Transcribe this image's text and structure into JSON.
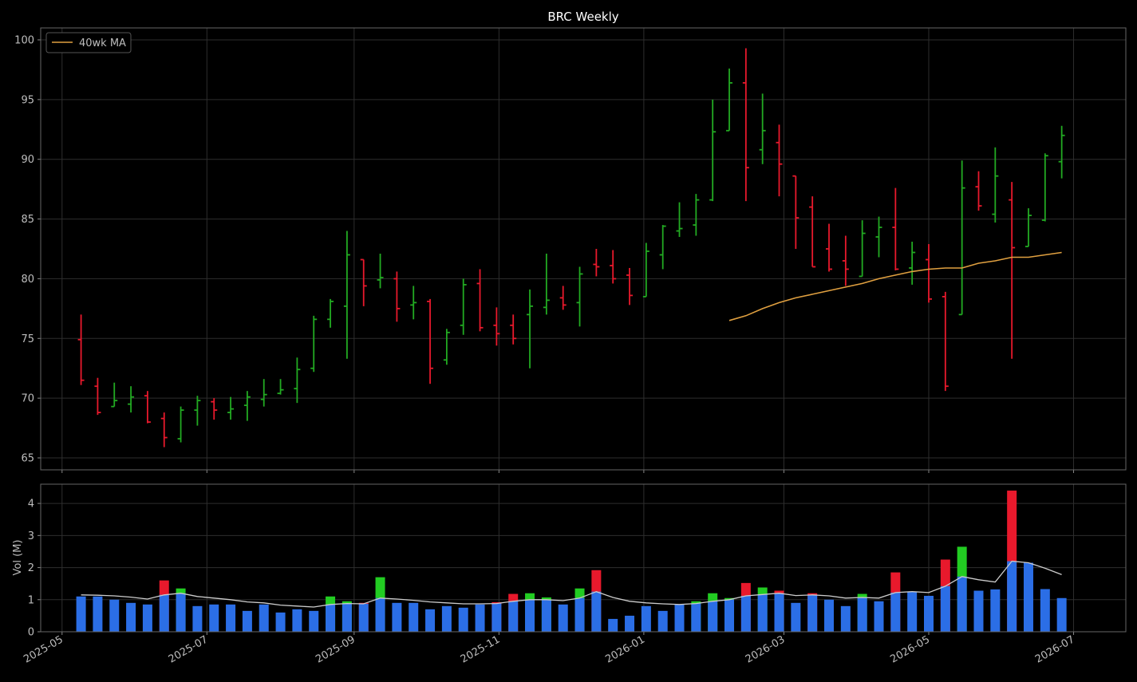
{
  "chart_data": [
    {
      "type": "ohlc",
      "title": "BRC Weekly",
      "ylabel": "",
      "ylim": [
        64,
        101
      ],
      "yticks": [
        65,
        70,
        75,
        80,
        85,
        90,
        95,
        100
      ],
      "legend": {
        "placement": "top-left",
        "entries": [
          "40wk MA"
        ]
      },
      "grid": true,
      "colors": {
        "up": "#22aa22",
        "down": "#e8192c",
        "ma": "#e0a040"
      },
      "x_dates": [
        "2025-05-09",
        "2025-05-16",
        "2025-05-23",
        "2025-05-30",
        "2025-06-06",
        "2025-06-13",
        "2025-06-20",
        "2025-06-27",
        "2025-07-04",
        "2025-07-11",
        "2025-07-18",
        "2025-07-25",
        "2025-08-01",
        "2025-08-08",
        "2025-08-15",
        "2025-08-22",
        "2025-08-29",
        "2025-09-05",
        "2025-09-12",
        "2025-09-19",
        "2025-09-26",
        "2025-10-03",
        "2025-10-10",
        "2025-10-17",
        "2025-10-24",
        "2025-10-31",
        "2025-11-07",
        "2025-11-14",
        "2025-11-21",
        "2025-11-28",
        "2025-12-05",
        "2025-12-12",
        "2025-12-19",
        "2025-12-26",
        "2026-01-02",
        "2026-01-09",
        "2026-01-16",
        "2026-01-23",
        "2026-01-30",
        "2026-02-06",
        "2026-02-13",
        "2026-02-20",
        "2026-02-27",
        "2026-03-06",
        "2026-03-13",
        "2026-03-20",
        "2026-03-27",
        "2026-04-03",
        "2026-04-10",
        "2026-04-17",
        "2026-04-24",
        "2026-05-01",
        "2026-05-08",
        "2026-05-15",
        "2026-05-22",
        "2026-05-29",
        "2026-06-05",
        "2026-06-12",
        "2026-06-19",
        "2026-06-26"
      ],
      "ohlc": [
        [
          74.9,
          77.0,
          71.1,
          71.5
        ],
        [
          71.0,
          71.7,
          68.6,
          68.8
        ],
        [
          69.3,
          71.3,
          69.3,
          69.8
        ],
        [
          69.5,
          71.0,
          68.8,
          70.1
        ],
        [
          70.2,
          70.6,
          67.9,
          68.0
        ],
        [
          68.3,
          68.8,
          65.9,
          66.7
        ],
        [
          66.6,
          69.3,
          66.3,
          69.0
        ],
        [
          69.0,
          70.2,
          67.7,
          69.8
        ],
        [
          69.7,
          70.0,
          68.2,
          69.0
        ],
        [
          68.8,
          70.1,
          68.2,
          69.1
        ],
        [
          69.4,
          70.6,
          68.1,
          70.1
        ],
        [
          69.9,
          71.6,
          69.3,
          70.3
        ],
        [
          70.4,
          71.6,
          70.3,
          70.7
        ],
        [
          70.8,
          73.4,
          69.6,
          72.4
        ],
        [
          72.5,
          76.9,
          72.2,
          76.6
        ],
        [
          76.6,
          78.3,
          75.9,
          78.1
        ],
        [
          77.7,
          84.0,
          73.3,
          82.0
        ],
        [
          81.6,
          81.6,
          77.7,
          79.4
        ],
        [
          79.9,
          82.1,
          79.2,
          80.1
        ],
        [
          80.0,
          80.6,
          76.4,
          77.5
        ],
        [
          77.8,
          79.4,
          76.6,
          78.0
        ],
        [
          78.1,
          78.3,
          71.2,
          72.5
        ],
        [
          73.2,
          75.8,
          72.8,
          75.5
        ],
        [
          76.1,
          80.0,
          75.3,
          79.5
        ],
        [
          79.6,
          80.8,
          75.6,
          75.9
        ],
        [
          76.1,
          77.6,
          74.4,
          75.4
        ],
        [
          76.1,
          77.0,
          74.5,
          75.0
        ],
        [
          77.0,
          79.1,
          72.5,
          77.7
        ],
        [
          77.6,
          82.1,
          77.0,
          78.2
        ],
        [
          78.4,
          79.4,
          77.4,
          77.8
        ],
        [
          78.0,
          81.0,
          76.0,
          80.4
        ],
        [
          81.2,
          82.5,
          80.2,
          81.0
        ],
        [
          81.1,
          82.4,
          79.6,
          80.0
        ],
        [
          80.3,
          80.9,
          77.8,
          78.6
        ],
        [
          78.5,
          83.0,
          78.5,
          82.3
        ],
        [
          82.0,
          84.5,
          80.8,
          84.4
        ],
        [
          84.0,
          86.4,
          83.5,
          84.2
        ],
        [
          84.5,
          87.1,
          83.6,
          86.6
        ],
        [
          86.6,
          95.0,
          86.5,
          92.3
        ],
        [
          92.4,
          97.6,
          92.4,
          96.4
        ],
        [
          96.4,
          99.3,
          86.5,
          89.3
        ],
        [
          90.8,
          95.5,
          89.6,
          92.4
        ],
        [
          91.4,
          92.9,
          86.9,
          89.6
        ],
        [
          88.6,
          88.6,
          82.5,
          85.1
        ],
        [
          86.0,
          86.9,
          81.0,
          81.0
        ],
        [
          82.5,
          84.6,
          80.6,
          80.8
        ],
        [
          81.5,
          83.6,
          79.4,
          80.8
        ],
        [
          80.2,
          84.9,
          80.2,
          83.8
        ],
        [
          83.5,
          85.2,
          81.8,
          84.3
        ],
        [
          84.3,
          87.6,
          80.7,
          80.8
        ],
        [
          80.9,
          83.1,
          79.5,
          82.2
        ],
        [
          81.6,
          82.9,
          78.0,
          78.3
        ],
        [
          78.5,
          78.9,
          70.6,
          71.0
        ],
        [
          77.0,
          89.9,
          77.0,
          87.6
        ],
        [
          87.7,
          89.0,
          85.7,
          86.1
        ],
        [
          85.4,
          91.0,
          84.7,
          88.6
        ],
        [
          86.6,
          88.1,
          73.3,
          82.6
        ],
        [
          82.7,
          85.9,
          82.7,
          85.3
        ],
        [
          84.9,
          90.5,
          84.8,
          90.3
        ],
        [
          89.8,
          92.8,
          88.4,
          92.0
        ]
      ],
      "series": [
        {
          "name": "40wk MA",
          "start_index": 39,
          "values": [
            76.5,
            76.9,
            77.5,
            78.0,
            78.4,
            78.7,
            79.0,
            79.3,
            79.6,
            80.0,
            80.3,
            80.6,
            80.8,
            80.9,
            80.9,
            81.3,
            81.5,
            81.8,
            81.8,
            82.0,
            82.2,
            82.6
          ]
        }
      ]
    },
    {
      "type": "bar",
      "ylabel": "Vol (M)",
      "ylim": [
        0,
        4.6
      ],
      "yticks": [
        0,
        1,
        2,
        3,
        4
      ],
      "xticks": [
        "2025-05",
        "2025-07",
        "2025-09",
        "2025-11",
        "2026-01",
        "2026-03",
        "2026-05",
        "2026-07"
      ],
      "grid": true,
      "colors": {
        "up": "#22cc22",
        "down": "#e8192c",
        "base": "#2b6ee6",
        "ma": "#cccccc"
      },
      "volume": [
        1.1,
        1.1,
        1.0,
        0.9,
        0.85,
        1.6,
        1.35,
        0.8,
        0.85,
        0.85,
        0.65,
        0.85,
        0.6,
        0.7,
        0.65,
        1.1,
        0.95,
        0.9,
        1.7,
        0.9,
        0.9,
        0.7,
        0.8,
        0.75,
        0.85,
        0.92,
        1.18,
        1.2,
        1.07,
        0.85,
        1.35,
        1.92,
        0.4,
        0.5,
        0.8,
        0.65,
        0.85,
        0.95,
        1.2,
        1.05,
        1.52,
        1.38,
        1.28,
        0.9,
        1.2,
        1.0,
        0.8,
        1.18,
        0.95,
        1.85,
        1.25,
        1.12,
        2.25,
        2.65,
        1.28,
        1.32,
        4.4,
        2.15,
        1.33,
        1.05
      ],
      "volume_ma": [
        1.15,
        1.14,
        1.12,
        1.08,
        1.02,
        1.15,
        1.2,
        1.1,
        1.05,
        1.0,
        0.93,
        0.9,
        0.83,
        0.8,
        0.77,
        0.85,
        0.88,
        0.87,
        1.05,
        1.02,
        0.98,
        0.93,
        0.9,
        0.87,
        0.87,
        0.88,
        0.95,
        1.0,
        1.0,
        0.97,
        1.05,
        1.25,
        1.07,
        0.95,
        0.9,
        0.87,
        0.85,
        0.88,
        0.95,
        1.0,
        1.12,
        1.16,
        1.2,
        1.13,
        1.15,
        1.12,
        1.05,
        1.07,
        1.05,
        1.22,
        1.25,
        1.22,
        1.42,
        1.72,
        1.62,
        1.55,
        2.2,
        2.15,
        1.98,
        1.78
      ]
    }
  ]
}
